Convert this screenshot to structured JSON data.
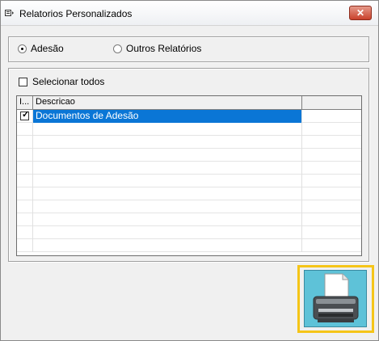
{
  "window": {
    "title": "Relatorios Personalizados",
    "close_label": "✕"
  },
  "report_type": {
    "options": [
      {
        "label": "Adesão",
        "selected": true
      },
      {
        "label": "Outros Relatórios",
        "selected": false
      }
    ]
  },
  "select_all": {
    "label": "Selecionar todos",
    "checked": false
  },
  "grid": {
    "columns": [
      "I...",
      "Descricao"
    ],
    "rows": [
      {
        "checked": true,
        "descricao": "Documentos de Adesão",
        "selected": true
      }
    ]
  },
  "print_button": {
    "icon": "printer-icon"
  },
  "colors": {
    "selection": "#0a76d6",
    "highlight": "#f5c518",
    "print_bg": "#5ec2d8"
  }
}
